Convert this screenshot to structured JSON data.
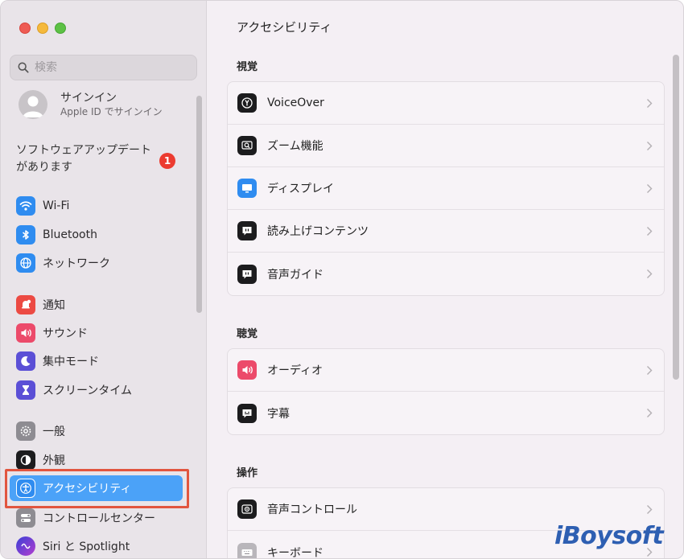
{
  "window": {
    "colors": {
      "accent": "#4ba2f8",
      "highlight_box": "#e1553f",
      "badge": "#ec3b30"
    }
  },
  "sidebar": {
    "search": {
      "placeholder": "検索",
      "icon": "magnifier-icon"
    },
    "account": {
      "title": "サインイン",
      "subtitle": "Apple ID でサインイン"
    },
    "update": {
      "text": "ソフトウェアアップデートがあります",
      "badge_count": "1"
    },
    "items": [
      {
        "label": "Wi-Fi",
        "icon": "wifi-icon",
        "color": "#2f8cf0"
      },
      {
        "label": "Bluetooth",
        "icon": "bluetooth-icon",
        "color": "#2f8cf0"
      },
      {
        "label": "ネットワーク",
        "icon": "globe-icon",
        "color": "#2f8cf0"
      },
      {
        "label": "通知",
        "icon": "bell-icon",
        "color": "#ec4a43"
      },
      {
        "label": "サウンド",
        "icon": "speaker-icon",
        "color": "#ec4a6a"
      },
      {
        "label": "集中モード",
        "icon": "moon-icon",
        "color": "#5b4fd6"
      },
      {
        "label": "スクリーンタイム",
        "icon": "hourglass-icon",
        "color": "#5b4fd6"
      },
      {
        "label": "一般",
        "icon": "gear-icon",
        "color": "#8e8c92"
      },
      {
        "label": "外観",
        "icon": "appearance-icon",
        "color": "#1c1c1e"
      },
      {
        "label": "アクセシビリティ",
        "icon": "accessibility-icon",
        "color": "#2f8cf0",
        "selected": true
      },
      {
        "label": "コントロールセンター",
        "icon": "control-center-icon",
        "color": "#8e8c92"
      },
      {
        "label": "Siri と Spotlight",
        "icon": "siri-icon",
        "color": "#6d3fd0"
      }
    ]
  },
  "main": {
    "title": "アクセシビリティ",
    "sections": [
      {
        "title": "視覚",
        "rows": [
          {
            "label": "VoiceOver",
            "icon": "voiceover-icon"
          },
          {
            "label": "ズーム機能",
            "icon": "zoom-icon"
          },
          {
            "label": "ディスプレイ",
            "icon": "display-icon"
          },
          {
            "label": "読み上げコンテンツ",
            "icon": "spoken-content-icon"
          },
          {
            "label": "音声ガイド",
            "icon": "descriptions-icon"
          }
        ]
      },
      {
        "title": "聴覚",
        "rows": [
          {
            "label": "オーディオ",
            "icon": "audio-icon"
          },
          {
            "label": "字幕",
            "icon": "captions-icon"
          }
        ]
      },
      {
        "title": "操作",
        "rows": [
          {
            "label": "音声コントロール",
            "icon": "voice-control-icon"
          },
          {
            "label": "キーボード",
            "icon": "keyboard-icon"
          }
        ]
      }
    ]
  },
  "watermark": "iBoysoft"
}
